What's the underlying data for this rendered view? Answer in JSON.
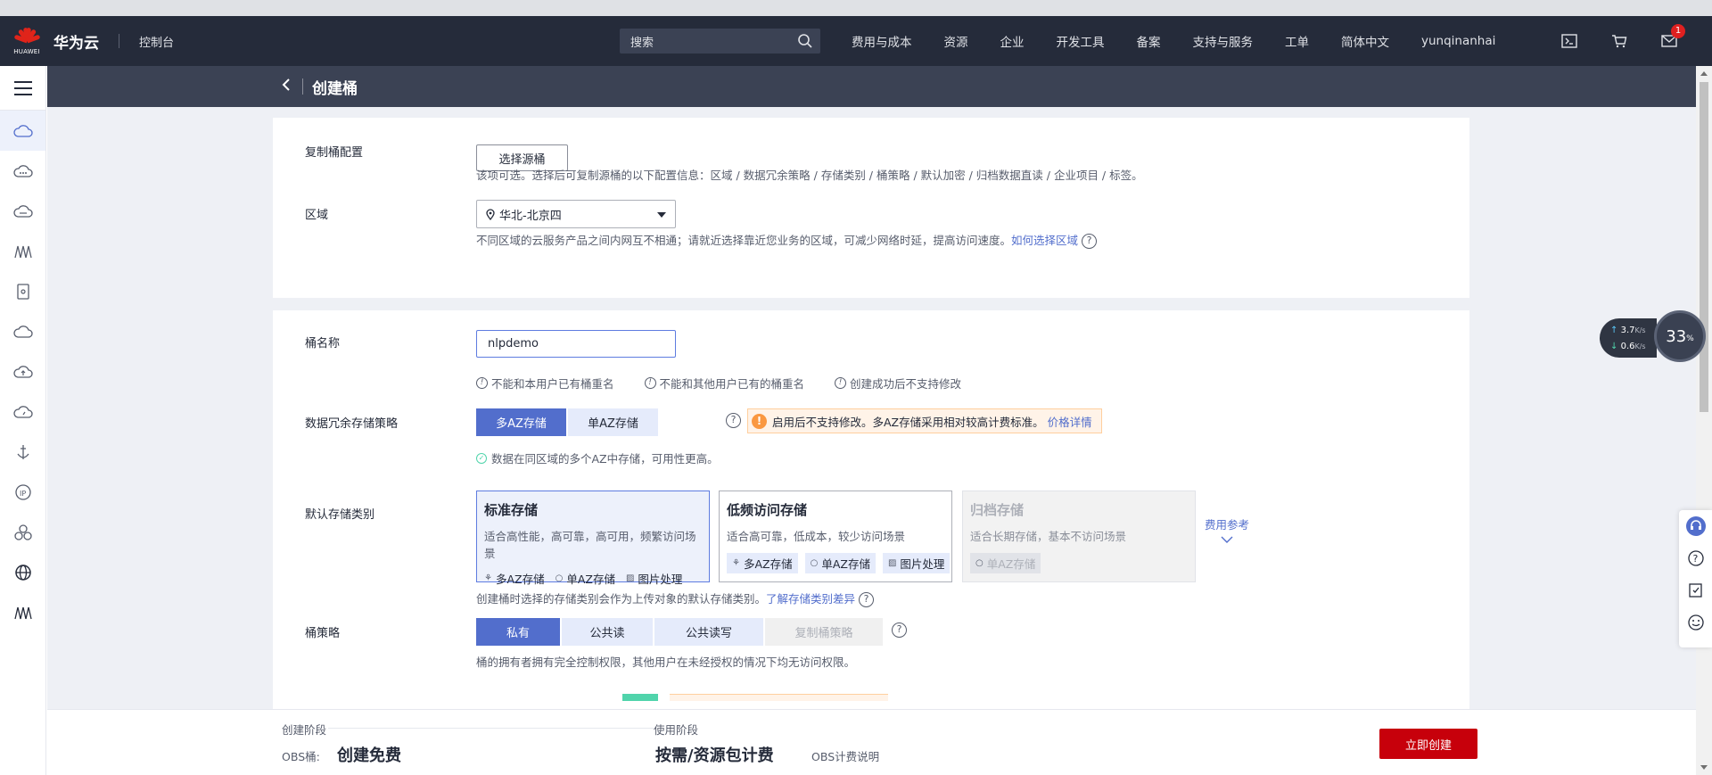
{
  "brand": {
    "logo_text": "HUAWEI",
    "name": "华为云",
    "console": "控制台"
  },
  "search": {
    "placeholder": "搜索"
  },
  "nav": {
    "links": [
      "费用与成本",
      "资源",
      "企业",
      "开发工具",
      "备案",
      "支持与服务",
      "工单",
      "简体中文",
      "yunqinanhai"
    ],
    "mail_badge": "1"
  },
  "page": {
    "title": "创建桶"
  },
  "replicate": {
    "label": "复制桶配置",
    "button": "选择源桶",
    "hint": "该项可选。选择后可复制源桶的以下配置信息：区域 / 数据冗余策略 / 存储类别 / 桶策略 / 默认加密 / 归档数据直读 / 企业项目 / 标签。"
  },
  "region": {
    "label": "区域",
    "value": "华北-北京四",
    "hint": "不同区域的云服务产品之间内网互不相通；请就近选择靠近您业务的区域，可减少网络时延，提高访问速度。",
    "link": "如何选择区域",
    "help": "?"
  },
  "bucket_name": {
    "label": "桶名称",
    "value": "nlpdemo",
    "rules": [
      "不能和本用户已有桶重名",
      "不能和其他用户已有的桶重名",
      "创建成功后不支持修改"
    ]
  },
  "redundancy": {
    "label": "数据冗余存储策略",
    "options": [
      "多AZ存储",
      "单AZ存储"
    ],
    "warning": "启用后不支持修改。多AZ存储采用相对较高计费标准。",
    "warning_link": "价格详情",
    "ok_hint": "数据在同区域的多个AZ中存储，可用性更高。"
  },
  "storage_class": {
    "label": "默认存储类别",
    "cards": [
      {
        "title": "标准存储",
        "desc": "适合高性能，高可靠，高可用，频繁访问场景",
        "chips": [
          "多AZ存储",
          "单AZ存储",
          "图片处理"
        ]
      },
      {
        "title": "低频访问存储",
        "desc": "适合高可靠，低成本，较少访问场景",
        "chips": [
          "多AZ存储",
          "单AZ存储",
          "图片处理"
        ]
      },
      {
        "title": "归档存储",
        "desc": "适合长期存储，基本不访问场景",
        "chips": [
          "单AZ存储"
        ]
      }
    ],
    "fee_ref": "费用参考",
    "hint": "创建桶时选择的存储类别会作为上传对象的默认存储类别。",
    "link": "了解存储类别差异"
  },
  "policy": {
    "label": "桶策略",
    "options": [
      "私有",
      "公共读",
      "公共读写",
      "复制桶策略"
    ],
    "hint": "桶的拥有者拥有完全控制权限，其他用户在未经授权的情况下均无访问权限。"
  },
  "footer": {
    "create_stage": "创建阶段",
    "obs_label": "OBS桶:",
    "create_fee": "创建免费",
    "use_stage": "使用阶段",
    "use_fee": "按需/资源包计费",
    "billing_link": "OBS计费说明",
    "create_button": "立即创建"
  },
  "overlay": {
    "up_speed": "3.7",
    "down_speed": "0.6",
    "unit": "K/s",
    "cpu": "33",
    "cpu_unit": "%"
  }
}
